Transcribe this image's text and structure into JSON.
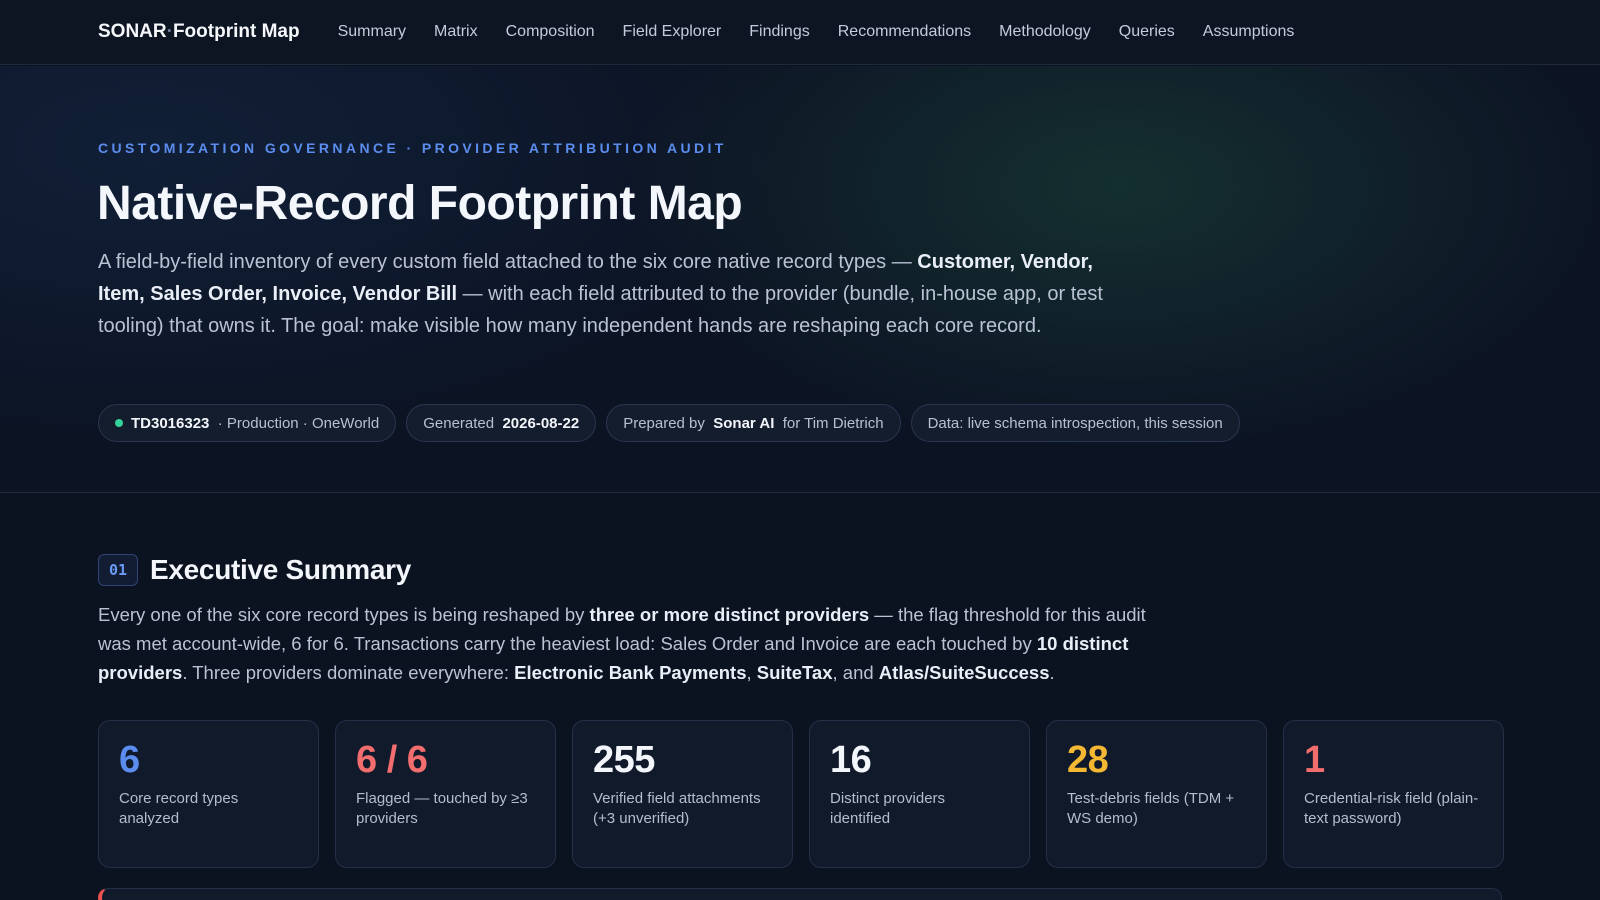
{
  "topbar": {
    "brand_part1": "SONAR",
    "brand_sep": "·",
    "brand_part2": "Footprint Map",
    "nav": [
      "Summary",
      "Matrix",
      "Composition",
      "Field Explorer",
      "Findings",
      "Recommendations",
      "Methodology",
      "Queries",
      "Assumptions"
    ]
  },
  "hero": {
    "eyebrow": "CUSTOMIZATION GOVERNANCE · PROVIDER ATTRIBUTION AUDIT",
    "title": "Native-Record Footprint Map",
    "desc_1": "A field-by-field inventory of every custom field attached to the six core native record types — ",
    "desc_bold": "Customer, Vendor, Item, Sales Order, Invoice, Vendor Bill",
    "desc_2": " — with each field attributed to the provider (bundle, in-house app, or test tooling) that owns it. The goal: make visible how many independent hands are reshaping each core record.",
    "pills": {
      "account_id": "TD3016323",
      "account_env": "· Production · OneWorld",
      "generated_label": "Generated",
      "generated_date": "2026-08-22",
      "prepared_label": "Prepared by",
      "prepared_by": "Sonar AI",
      "prepared_for": "for Tim Dietrich",
      "data_source": "Data: live schema introspection, this session"
    }
  },
  "summary": {
    "badge": "01",
    "title": "Executive Summary",
    "t1": "Every one of the six core record types is being reshaped by ",
    "b1": "three or more distinct providers",
    "t2": " — the flag threshold for this audit was met account-wide, 6 for 6. Transactions carry the heaviest load: Sales Order and Invoice are each touched by ",
    "b2": "10 distinct providers",
    "t3": ". Three providers dominate everywhere: ",
    "b3": "Electronic Bank Payments",
    "t4": ", ",
    "b4": "SuiteTax",
    "t5": ", and ",
    "b5": "Atlas/SuiteSuccess",
    "t6": "."
  },
  "stats": [
    {
      "value": "6",
      "label": "Core record types analyzed",
      "color": "#5b8def"
    },
    {
      "value": "6 / 6",
      "label": "Flagged — touched by ≥3 providers",
      "color": "#f26d6d"
    },
    {
      "value": "255",
      "label": "Verified field attachments (+3 unverified)",
      "color": "#f3f6fb"
    },
    {
      "value": "16",
      "label": "Distinct providers identified",
      "color": "#f3f6fb"
    },
    {
      "value": "28",
      "label": "Test-debris fields (TDM + WS demo)",
      "color": "#f5b833"
    },
    {
      "value": "1",
      "label": "Credential-risk field (plain-text password)",
      "color": "#f26d6d"
    }
  ],
  "colors": {
    "accent": "#5b8def",
    "status_ok": "#34d399",
    "danger": "#f26d6d",
    "warning": "#f5b833"
  }
}
